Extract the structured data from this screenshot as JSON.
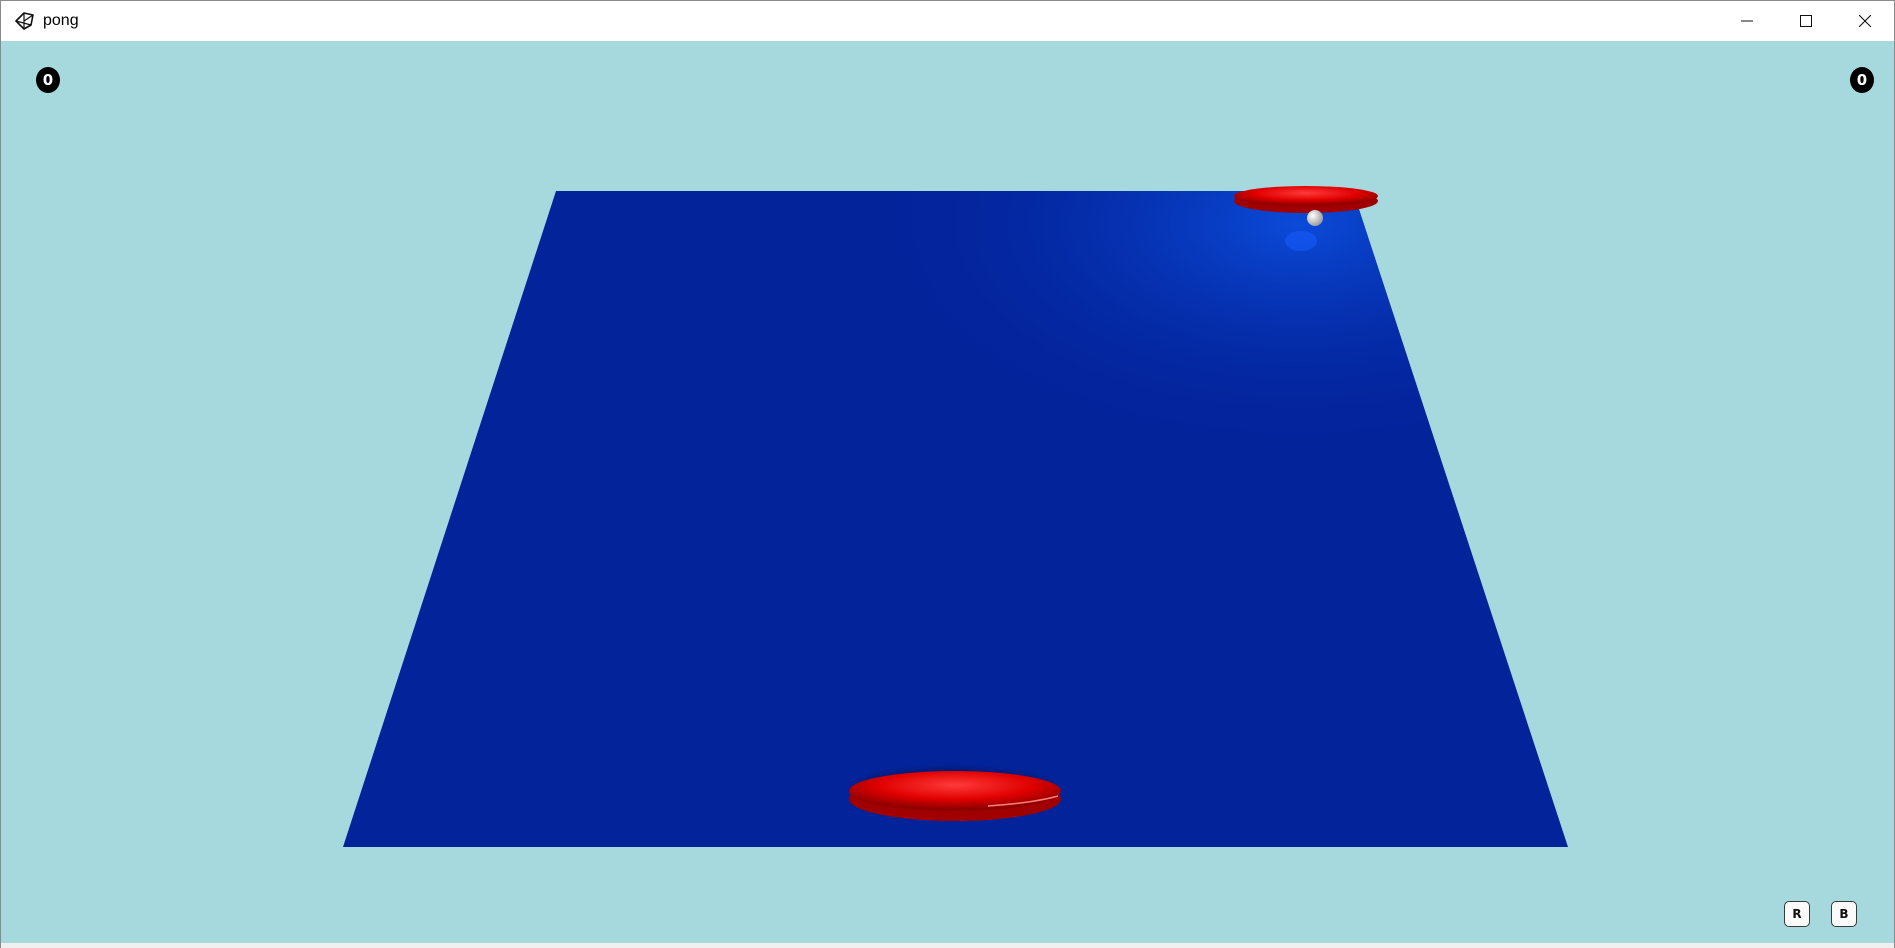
{
  "window": {
    "title": "pong",
    "controls": [
      "minimize-icon",
      "maximize-icon",
      "close-icon"
    ]
  },
  "game": {
    "score_left": "0",
    "score_right": "0",
    "buttons": {
      "r_label": "R",
      "b_label": "B"
    },
    "colors": {
      "background": "#a6d9de",
      "table": "#03239b",
      "paddle": "#ff0000",
      "ball": "#ffffff"
    }
  }
}
